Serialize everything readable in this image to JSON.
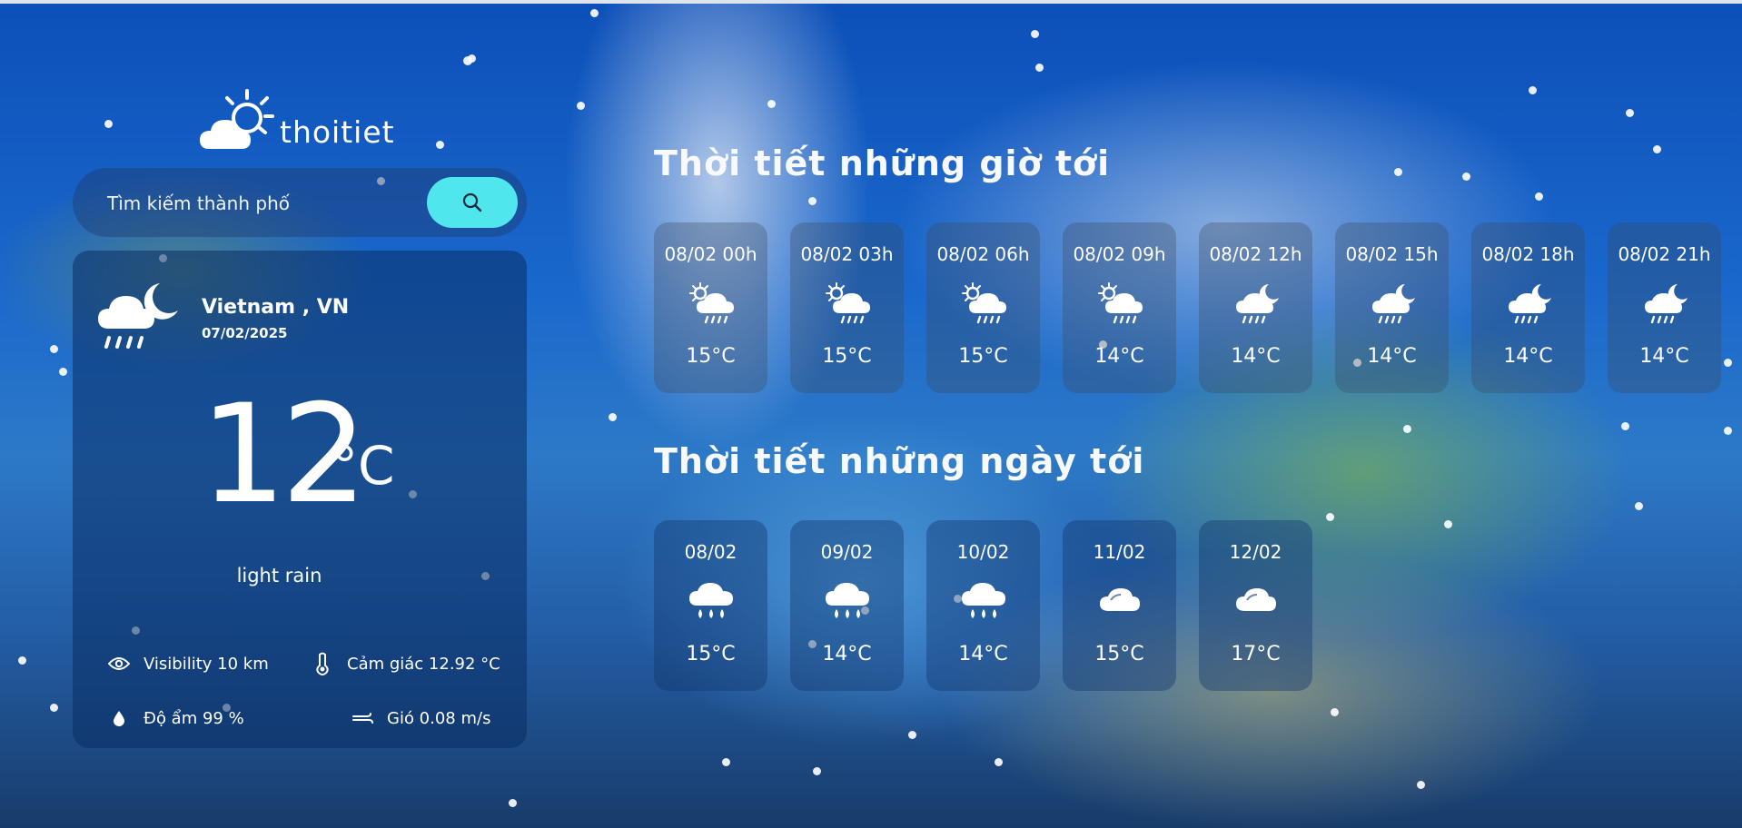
{
  "logo": {
    "text": "thoitiet"
  },
  "search": {
    "placeholder": "Tìm kiếm thành phố"
  },
  "current": {
    "city": "Vietnam , VN",
    "date": "07/02/2025",
    "temperature": "12",
    "unit": "°C",
    "description": "light rain",
    "icon": "cloud-moon-rain-icon",
    "details": {
      "visibility": "Visibility 10 km",
      "feels_like": "Cảm giác 12.92 °C",
      "humidity": "Độ ẩm 99 %",
      "wind": "Gió 0.08 m/s"
    }
  },
  "hourly": {
    "title": "Thời tiết những giờ tới",
    "items": [
      {
        "time": "08/02 00h",
        "temp": "15°C",
        "icon": "sun-cloud-rain-icon"
      },
      {
        "time": "08/02 03h",
        "temp": "15°C",
        "icon": "sun-cloud-rain-icon"
      },
      {
        "time": "08/02 06h",
        "temp": "15°C",
        "icon": "sun-cloud-rain-icon"
      },
      {
        "time": "08/02 09h",
        "temp": "14°C",
        "icon": "sun-cloud-rain-icon"
      },
      {
        "time": "08/02 12h",
        "temp": "14°C",
        "icon": "moon-cloud-rain-icon"
      },
      {
        "time": "08/02 15h",
        "temp": "14°C",
        "icon": "moon-cloud-rain-icon"
      },
      {
        "time": "08/02 18h",
        "temp": "14°C",
        "icon": "moon-cloud-rain-icon"
      },
      {
        "time": "08/02 21h",
        "temp": "14°C",
        "icon": "moon-cloud-rain-icon"
      }
    ]
  },
  "daily": {
    "title": "Thời tiết những ngày tới",
    "items": [
      {
        "date": "08/02",
        "temp": "15°C",
        "icon": "cloud-rain-icon"
      },
      {
        "date": "09/02",
        "temp": "14°C",
        "icon": "cloud-rain-icon"
      },
      {
        "date": "10/02",
        "temp": "14°C",
        "icon": "cloud-rain-icon"
      },
      {
        "date": "11/02",
        "temp": "15°C",
        "icon": "cloud-icon"
      },
      {
        "date": "12/02",
        "temp": "17°C",
        "icon": "cloud-icon"
      }
    ]
  },
  "colors": {
    "search_button": "#4fe6ee",
    "text": "#ffffff"
  }
}
